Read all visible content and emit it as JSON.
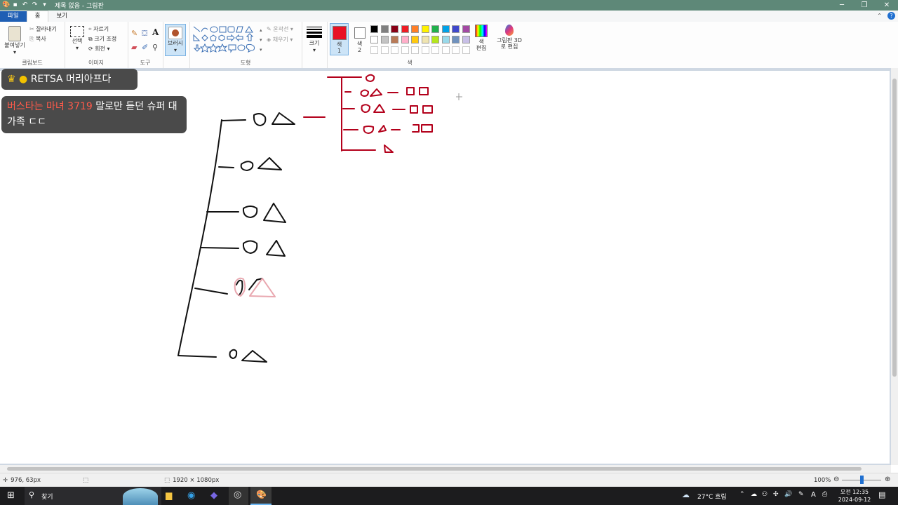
{
  "window": {
    "title": "제목 없음 - 그림판"
  },
  "tabs": {
    "file": "파일",
    "home": "홈",
    "view": "보기"
  },
  "clipboard": {
    "paste": "붙여넣기",
    "cut": "잘라내기",
    "copy": "복사",
    "label": "클립보드"
  },
  "image": {
    "select": "선택",
    "crop": "자르기",
    "resize": "크기 조정",
    "rotate": "회전",
    "label": "이미지"
  },
  "tools": {
    "label": "도구"
  },
  "brushes": {
    "label": "브러시"
  },
  "shapes": {
    "outline": "윤곽선",
    "fill": "채우기",
    "label": "도형"
  },
  "size": {
    "label": "크기"
  },
  "colors": {
    "color1": "색\n1",
    "color2": "색\n2",
    "edit": "색\n편집",
    "label": "색",
    "color1_value": "#e81123",
    "color2_value": "#ffffff",
    "palette": [
      "#000000",
      "#7f7f7f",
      "#880015",
      "#ed1c24",
      "#ff7f27",
      "#fff200",
      "#22b14c",
      "#00a2e8",
      "#3f48cc",
      "#a349a4",
      "#ffffff",
      "#c3c3c3",
      "#b97a57",
      "#ffaec9",
      "#ffc90e",
      "#efe4b0",
      "#b5e61d",
      "#99d9ea",
      "#7092be",
      "#c8bfe7"
    ]
  },
  "paint3d": {
    "label": "그림판 3D로 편집"
  },
  "chat": {
    "message1": {
      "name": "RETSA 머리아프다"
    },
    "message2": {
      "highlight": "버스타는 마녀 3719",
      "text": " 말로만 듣던 슈퍼 대가족 ㄷㄷ"
    }
  },
  "status": {
    "cursor": "976, 63px",
    "canvas_size": "1920 × 1080px",
    "zoom": "100%",
    "zoom_level": 1.0
  },
  "taskbar": {
    "search": "찾기",
    "weather": "27°C 흐림",
    "time": "오전 12:35",
    "date": "2024-09-12",
    "ime": "A"
  }
}
